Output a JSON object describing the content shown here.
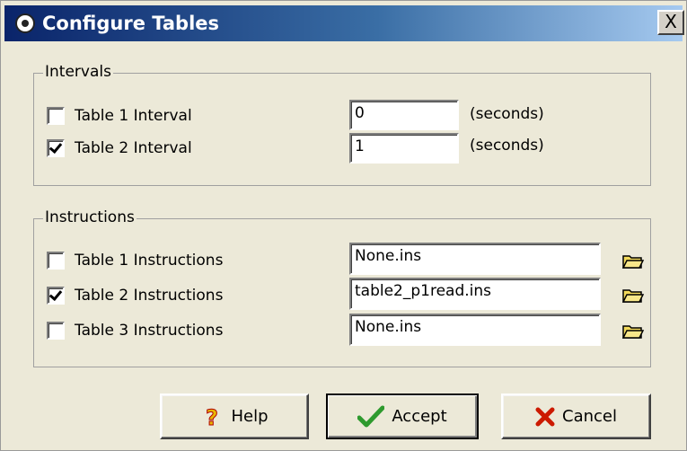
{
  "window": {
    "title": "Configure Tables",
    "close_label": "X"
  },
  "intervals": {
    "group_label": "Intervals",
    "unit_label": "(seconds)",
    "rows": [
      {
        "label": "Table 1 Interval",
        "checked": false,
        "value": "0"
      },
      {
        "label": "Table 2 Interval",
        "checked": true,
        "value": "1"
      }
    ]
  },
  "instructions": {
    "group_label": "Instructions",
    "rows": [
      {
        "label": "Table 1 Instructions",
        "checked": false,
        "value": "None.ins"
      },
      {
        "label": "Table 2 Instructions",
        "checked": true,
        "value": "table2_p1read.ins"
      },
      {
        "label": "Table 3 Instructions",
        "checked": false,
        "value": "None.ins"
      }
    ]
  },
  "buttons": {
    "help": "Help",
    "accept": "Accept",
    "cancel": "Cancel"
  },
  "icons": {
    "help": "question-icon",
    "accept": "checkmark-icon",
    "cancel": "x-icon",
    "browse": "folder-icon"
  },
  "colors": {
    "title_bar": "#0a246a",
    "help_icon": "#e8b800",
    "accept_icon": "#2e9a2e",
    "cancel_icon": "#cc1a00"
  }
}
